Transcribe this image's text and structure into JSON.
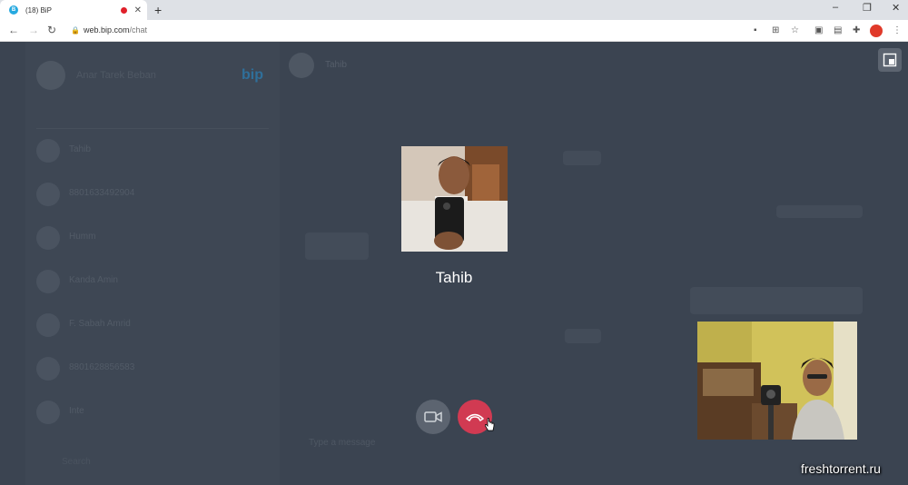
{
  "browser": {
    "tab": {
      "badge": "B",
      "title": "(18) BiP"
    },
    "newtab": "+",
    "controls": {
      "minimize": "–",
      "maximize": "❐",
      "close": "✕"
    },
    "nav": {
      "back": "←",
      "forward": "→",
      "reload": "↻"
    },
    "url": {
      "host": "web.bip.com",
      "path": "/chat"
    }
  },
  "sidebar": {
    "user_name": "Anar Tarek Beban",
    "logo": "bip",
    "chats": [
      {
        "name": "Tahib",
        "preview": ""
      },
      {
        "name": "8801633492904",
        "preview": ""
      },
      {
        "name": "Humm",
        "preview": ""
      },
      {
        "name": "Kanda Amin",
        "preview": ""
      },
      {
        "name": "F. Sabah Amrid",
        "preview": ""
      },
      {
        "name": "8801628856583",
        "preview": ""
      },
      {
        "name": "Inte",
        "preview": ""
      }
    ],
    "footer": "Search"
  },
  "chat": {
    "contact": "Tahib",
    "status": "",
    "compose_placeholder": "Type a message"
  },
  "call": {
    "callee_name": "Tahib",
    "video_icon": "video-camera-icon",
    "hangup_icon": "phone-hangup-icon",
    "hangup_color": "#d13a52"
  },
  "watermark": "freshtorrent.ru"
}
